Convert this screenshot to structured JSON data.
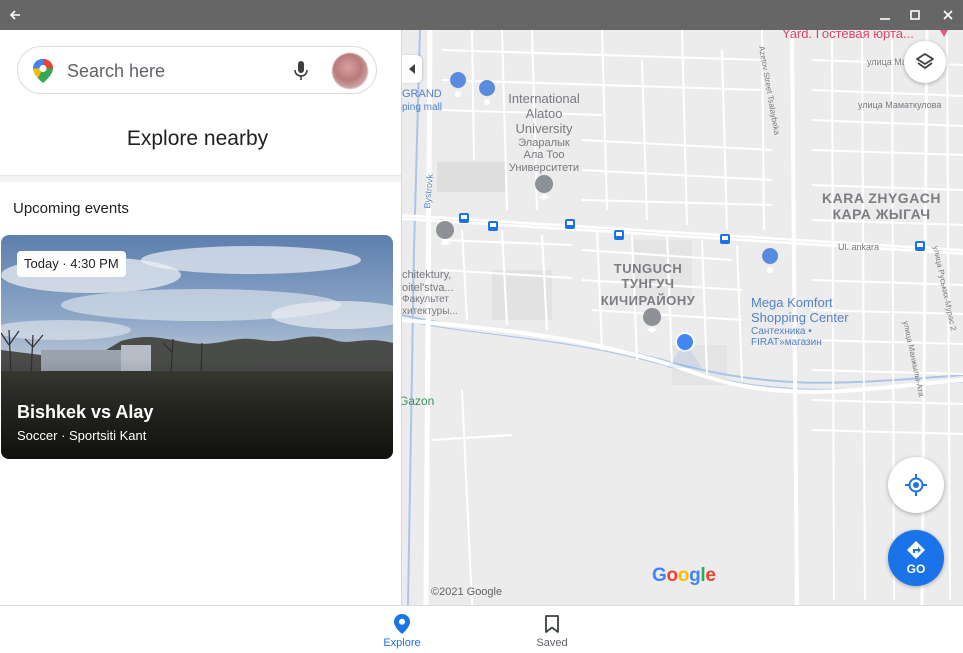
{
  "search": {
    "placeholder": "Search here"
  },
  "panel": {
    "heading": "Explore nearby",
    "section_title": "Upcoming events",
    "event": {
      "time": "Today · 4:30 PM",
      "title": "Bishkek vs Alay",
      "subtitle": "Soccer · Sportsiti Kant"
    }
  },
  "map": {
    "labels": {
      "yard": "Yard. Гостевая юрта...",
      "grand": "GRAND",
      "mall": "ping mall",
      "ial_line1": "International",
      "ial_line2": "Alatoo",
      "ial_line3": "University",
      "ial_ru1": "Эларалык",
      "ial_ru2": "Ала Тоо",
      "ial_ru3": "Университети",
      "kara_en": "KARA ZHYGACH",
      "kara_ru": "КАРА ЖЫГАЧ",
      "tunguch_1": "TUNGUCH",
      "tunguch_2": "ТУНГУЧ",
      "tunguch_3": "КИЧИРАЙОНУ",
      "mega_1": "Mega Komfort",
      "mega_2": "Shopping Center",
      "mega_3": "Сантехника •",
      "mega_4": "FIRAT»магазин",
      "arch_1": "chitektury,",
      "arch_2": "oitel'stva...",
      "arch_3": "Факультет",
      "arch_4": "хитектуры...",
      "gazon": "Gazon",
      "bystrovka": "Bystrovk",
      "ul_ankara": "Ul. ankara",
      "ul_ismagulova": "улица Ма",
      "ul_mamatkulova": "улица Маматкулова",
      "ul_tazalar": "Azetov Street Tsalaybekа",
      "ul_ruski": "улица Руських-Мурас 2",
      "ul_manzh": "улица Манжылы-Ата"
    },
    "copyright": "©2021 Google",
    "google_logo": [
      "G",
      "o",
      "o",
      "g",
      "l",
      "e"
    ],
    "go_label": "GO"
  },
  "nav": {
    "explore": "Explore",
    "saved": "Saved"
  },
  "colors": {
    "accent": "#1a73e8",
    "titlebar": "#666666",
    "map_bg": "#ececec",
    "road": "#ffffff",
    "water": "#a8c6ea"
  }
}
